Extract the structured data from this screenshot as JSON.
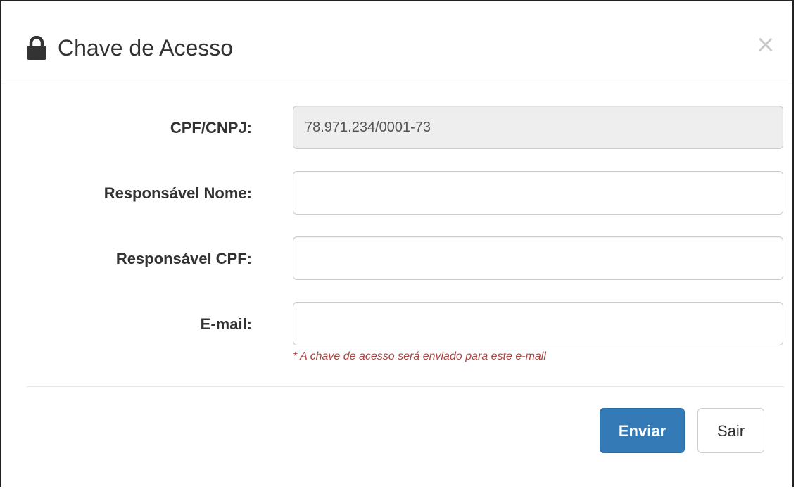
{
  "dialog": {
    "title": "Chave de Acesso",
    "close_symbol": "×",
    "icons": {
      "title": "lock-icon",
      "close": "close-icon"
    }
  },
  "form": {
    "cpf_cnpj": {
      "label": "CPF/CNPJ:",
      "value": "78.971.234/0001-73"
    },
    "responsavel_nome": {
      "label": "Responsável Nome:",
      "value": ""
    },
    "responsavel_cpf": {
      "label": "Responsável CPF:",
      "value": ""
    },
    "email": {
      "label": "E-mail:",
      "value": "",
      "help": "* A chave de acesso será enviado para este e-mail"
    }
  },
  "buttons": {
    "submit": "Enviar",
    "exit": "Sair"
  },
  "colors": {
    "primary": "#337ab7",
    "help_text": "#a94442",
    "readonly_bg": "#eeeeee"
  }
}
